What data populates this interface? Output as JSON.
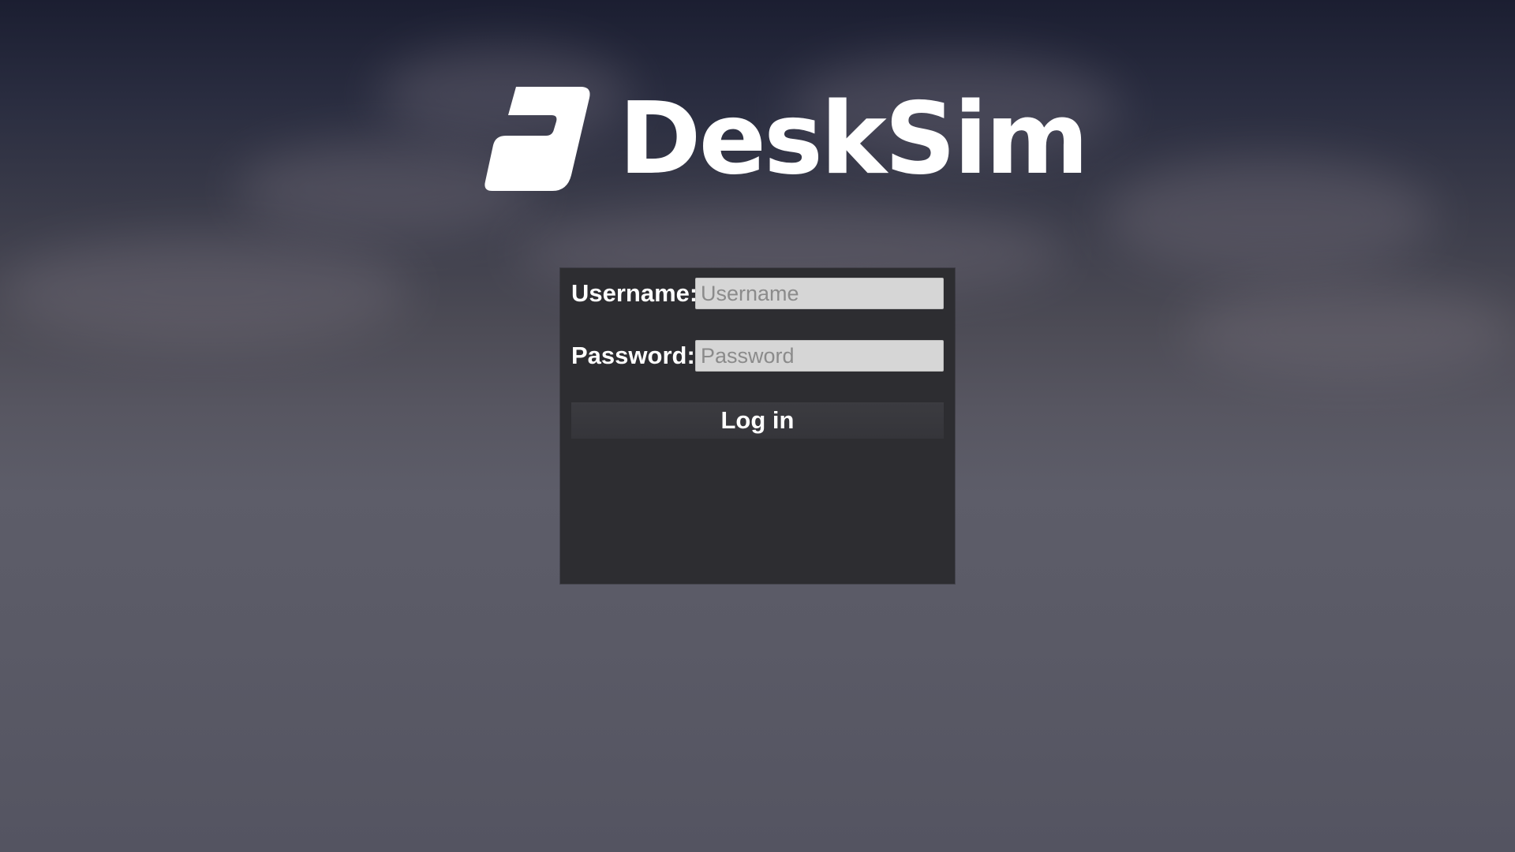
{
  "app": {
    "name": "DeskSim"
  },
  "login": {
    "username_label": "Username:",
    "username_placeholder": "Username",
    "username_value": "",
    "password_label": "Password:",
    "password_placeholder": "Password",
    "password_value": "",
    "submit_label": "Log in"
  },
  "icons": {
    "logo": "desksim-logo-icon"
  },
  "colors": {
    "panel_background": "#2d2d31",
    "input_background": "#d6d6d6",
    "button_background": "#3b3b40",
    "text": "#ffffff"
  }
}
